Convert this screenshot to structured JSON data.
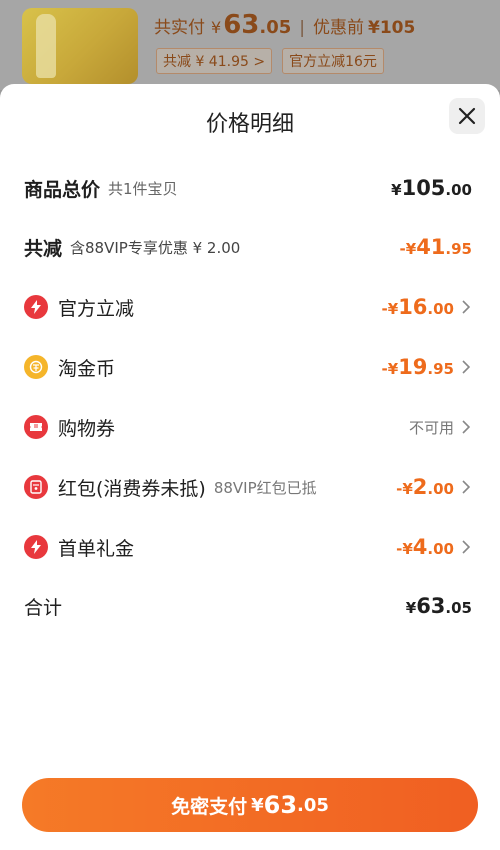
{
  "header": {
    "actual_pay_label": "共实付",
    "currency": "¥",
    "actual_int": "63",
    "actual_dec": ".05",
    "before_label": "优惠前",
    "before_value": "¥105",
    "tags": [
      "共减 ¥ 41.95 >",
      "官方立减16元"
    ]
  },
  "sheet": {
    "title": "价格明细",
    "rows": [
      {
        "label": "商品总价",
        "sub": "共1件宝贝",
        "yen": "¥",
        "int": "105",
        "dec": ".00"
      },
      {
        "label": "共减",
        "sub": "含88VIP专享优惠 ¥ 2.00",
        "yen": "-¥",
        "int": "41",
        "dec": ".95"
      },
      {
        "label": "官方立减",
        "yen": "-¥",
        "int": "16",
        "dec": ".00"
      },
      {
        "label": "淘金币",
        "yen": "-¥",
        "int": "19",
        "dec": ".95"
      },
      {
        "label": "购物券",
        "status": "不可用"
      },
      {
        "label": "红包(消费券未抵)",
        "sub": "88VIP红包已抵",
        "yen": "-¥",
        "int": "2",
        "dec": ".00"
      },
      {
        "label": "首单礼金",
        "yen": "-¥",
        "int": "4",
        "dec": ".00"
      },
      {
        "label": "合计",
        "yen": "¥",
        "int": "63",
        "dec": ".05"
      }
    ],
    "icons": [
      "lightning-icon",
      "coin-icon",
      "coupon-icon",
      "red-envelope-icon",
      "lightning-icon"
    ]
  },
  "pay_button": {
    "label": "免密支付",
    "yen": "¥",
    "int": "63",
    "dec": ".05"
  },
  "colors": {
    "accent": "#f06a21",
    "price_orange": "#ee6b1c",
    "icon_red": "#e8383d",
    "coin_gold": "#f5b52a"
  }
}
